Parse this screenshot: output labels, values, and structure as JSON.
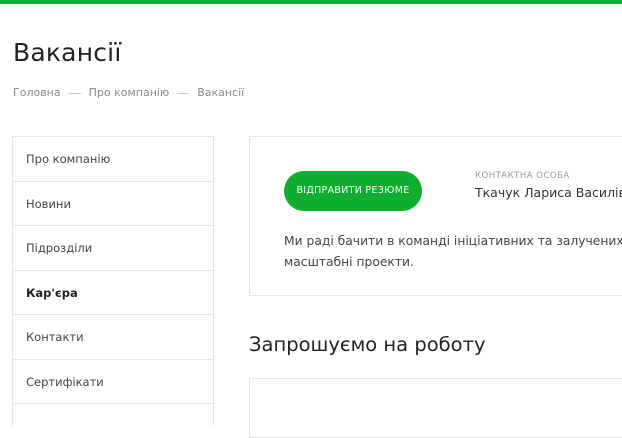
{
  "colors": {
    "accent": "#0fad2e",
    "border": "#e6e6e6"
  },
  "page": {
    "title": "Вакансії"
  },
  "breadcrumb": [
    "Головна",
    "Про компанію",
    "Вакансії"
  ],
  "sidebar": {
    "items": [
      {
        "label": "Про компанію"
      },
      {
        "label": "Новини"
      },
      {
        "label": "Підрозділи"
      },
      {
        "label": "Кар'єра",
        "active": true
      },
      {
        "label": "Контакти"
      },
      {
        "label": "Сертифікати"
      }
    ]
  },
  "card": {
    "button_label": "ВІДПРАВИТИ РЕЗЮМЕ",
    "contact_label": "КОНТАКТНА ОСОБА",
    "contact_name": "Ткачук Лариса Василів",
    "text_line1": "Ми раді бачити в команді ініціативних та залучених",
    "text_line2": "масштабні проекти."
  },
  "section": {
    "title": "Запрошуємо на роботу"
  }
}
